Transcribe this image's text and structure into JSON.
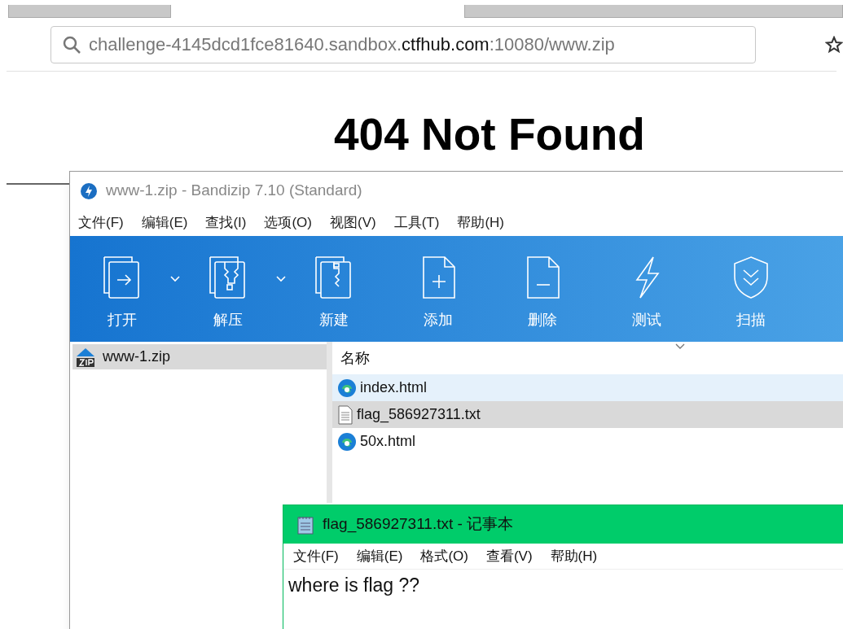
{
  "browser": {
    "address": {
      "prefix": "challenge-4145dcd1fce81640.sandbox.",
      "domain": "ctfhub.com",
      "suffix": ":10080/www.zip"
    }
  },
  "page": {
    "heading": "404 Not Found"
  },
  "archiver": {
    "title": "www-1.zip - Bandizip 7.10 (Standard)",
    "menu": [
      "文件(F)",
      "编辑(E)",
      "查找(I)",
      "选项(O)",
      "视图(V)",
      "工具(T)",
      "帮助(H)"
    ],
    "toolbar": [
      {
        "kind": "open",
        "label": "打开",
        "dropdown": true
      },
      {
        "kind": "extract",
        "label": "解压",
        "dropdown": true
      },
      {
        "kind": "new",
        "label": "新建",
        "dropdown": false
      },
      {
        "kind": "add",
        "label": "添加",
        "dropdown": false
      },
      {
        "kind": "delete",
        "label": "删除",
        "dropdown": false
      },
      {
        "kind": "test",
        "label": "测试",
        "dropdown": false
      },
      {
        "kind": "scan",
        "label": "扫描",
        "dropdown": false
      }
    ],
    "tree": [
      {
        "label": "www-1.zip",
        "selected": true
      }
    ],
    "column": "名称",
    "files": [
      {
        "kind": "html",
        "name": "index.html",
        "selected": false,
        "hovered": true
      },
      {
        "kind": "txt",
        "name": "flag_586927311.txt",
        "selected": true,
        "hovered": false
      },
      {
        "kind": "html",
        "name": "50x.html",
        "selected": false,
        "hovered": false
      }
    ]
  },
  "notepad": {
    "title": "flag_586927311.txt - 记事本",
    "menu": [
      "文件(F)",
      "编辑(E)",
      "格式(O)",
      "查看(V)",
      "帮助(H)"
    ],
    "content": "where is flag ??"
  }
}
